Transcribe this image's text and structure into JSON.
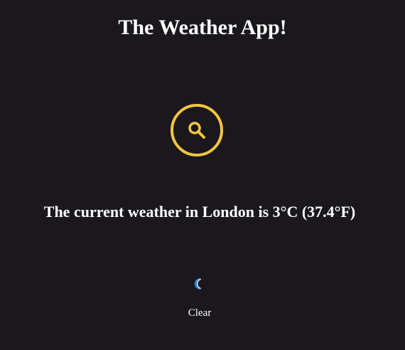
{
  "app": {
    "title": "The Weather App!"
  },
  "search": {
    "icon": "search-icon",
    "accent_color": "#f5c542"
  },
  "weather": {
    "summary": "The current weather in London is 3°C (37.4°F)",
    "condition_icon": "moon-icon",
    "condition_label": "Clear"
  },
  "colors": {
    "background": "#1a181c",
    "text": "#ffffff",
    "moon": "#1e88e5"
  }
}
